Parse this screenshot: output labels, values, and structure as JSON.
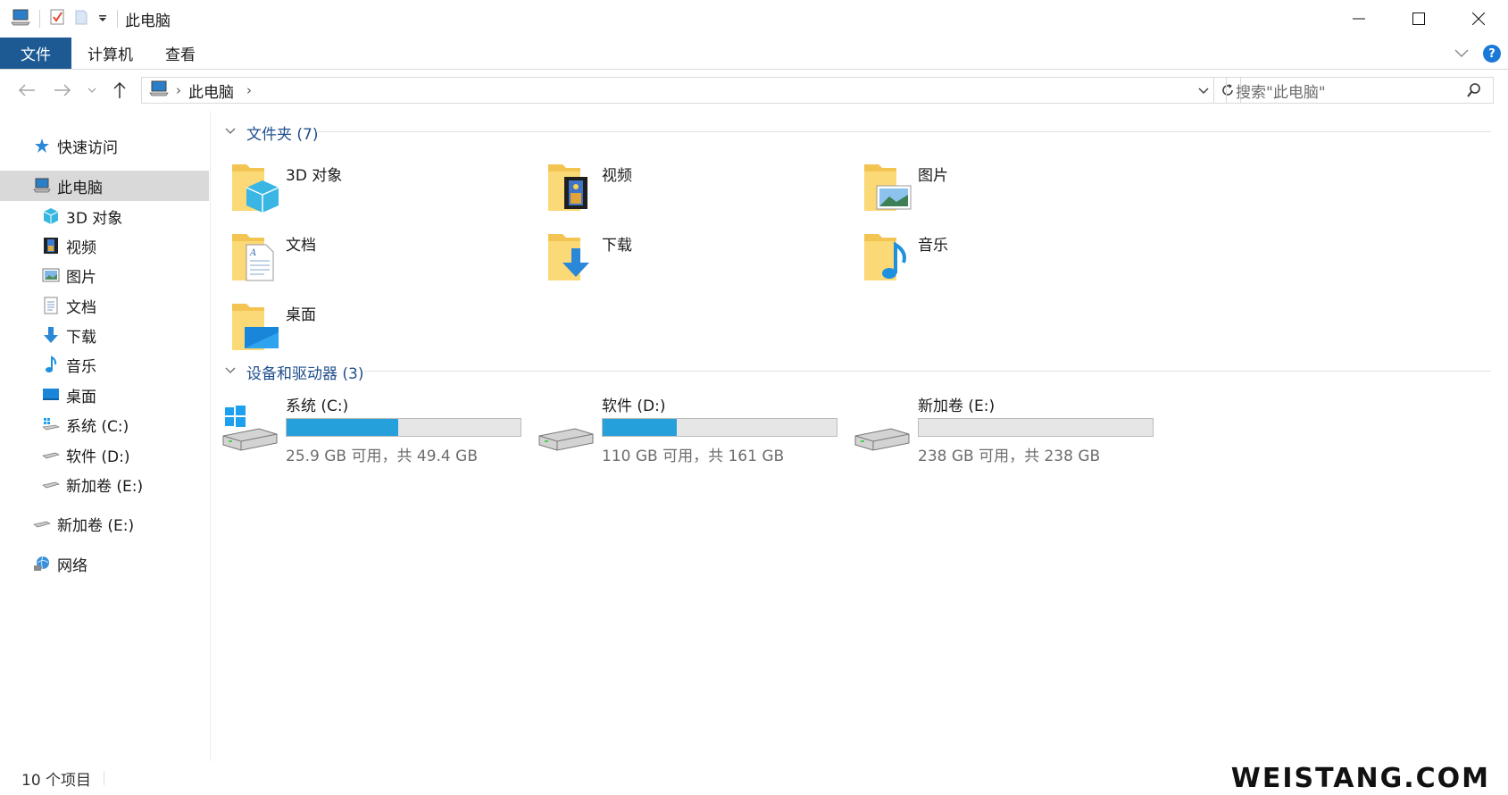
{
  "window": {
    "title": "此电脑"
  },
  "ribbon": {
    "tabs": [
      "文件",
      "计算机",
      "查看"
    ]
  },
  "address": {
    "crumb": "此电脑"
  },
  "search": {
    "placeholder": "搜索\"此电脑\""
  },
  "sidebar": {
    "items": [
      {
        "label": "快速访问",
        "icon": "star-icon"
      },
      {
        "label": "此电脑",
        "icon": "computer-icon",
        "selected": true
      },
      {
        "label": "3D 对象",
        "icon": "cube-icon"
      },
      {
        "label": "视频",
        "icon": "film-icon"
      },
      {
        "label": "图片",
        "icon": "picture-icon"
      },
      {
        "label": "文档",
        "icon": "document-icon"
      },
      {
        "label": "下载",
        "icon": "download-icon"
      },
      {
        "label": "音乐",
        "icon": "music-icon"
      },
      {
        "label": "桌面",
        "icon": "desktop-icon"
      },
      {
        "label": "系统 (C:)",
        "icon": "drive-icon"
      },
      {
        "label": "软件 (D:)",
        "icon": "drive-icon"
      },
      {
        "label": "新加卷 (E:)",
        "icon": "drive-icon"
      },
      {
        "label": "新加卷 (E:)",
        "icon": "drive-icon"
      },
      {
        "label": "网络",
        "icon": "network-icon"
      }
    ]
  },
  "groups": {
    "folders": {
      "title": "文件夹 (7)",
      "items": [
        {
          "label": "3D 对象",
          "icon": "cube-folder-icon"
        },
        {
          "label": "视频",
          "icon": "video-folder-icon"
        },
        {
          "label": "图片",
          "icon": "pictures-folder-icon"
        },
        {
          "label": "文档",
          "icon": "documents-folder-icon"
        },
        {
          "label": "下载",
          "icon": "downloads-folder-icon"
        },
        {
          "label": "音乐",
          "icon": "music-folder-icon"
        },
        {
          "label": "桌面",
          "icon": "desktop-folder-icon"
        }
      ]
    },
    "drives": {
      "title": "设备和驱动器 (3)",
      "items": [
        {
          "name": "系统 (C:)",
          "free": "25.9 GB 可用，共 49.4 GB",
          "used_fraction": 0.476
        },
        {
          "name": "软件 (D:)",
          "free": "110 GB 可用，共 161 GB",
          "used_fraction": 0.317
        },
        {
          "name": "新加卷 (E:)",
          "free": "238 GB 可用，共 238 GB",
          "used_fraction": 0.0
        }
      ]
    }
  },
  "status": {
    "count": "10 个项目"
  },
  "watermark": "WEISTANG.COM",
  "colors": {
    "file_tab": "#1d5a94",
    "drive_bar": "#26a0da",
    "group_title": "#1f4e8c",
    "selected_bg": "#d9d9d9"
  }
}
